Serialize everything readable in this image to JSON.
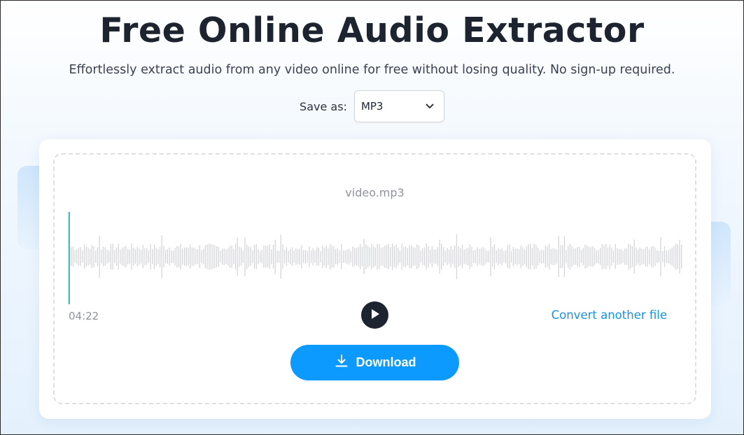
{
  "header": {
    "title": "Free Online Audio Extractor",
    "subtitle": "Effortlessly extract audio from any video online for free without losing quality. No sign-up required."
  },
  "format": {
    "label": "Save as:",
    "selected": "MP3"
  },
  "player": {
    "filename": "video.mp3",
    "duration": "04:22",
    "progress": 0,
    "convert_label": "Convert another file",
    "download_label": "Download"
  },
  "colors": {
    "accent": "#0c9aff",
    "link": "#1592e6",
    "waveform": "#d4d6d9",
    "playhead": "#17a2a2"
  },
  "icons": {
    "select": "chevron-down-icon",
    "play": "play-icon",
    "download": "download-icon"
  }
}
